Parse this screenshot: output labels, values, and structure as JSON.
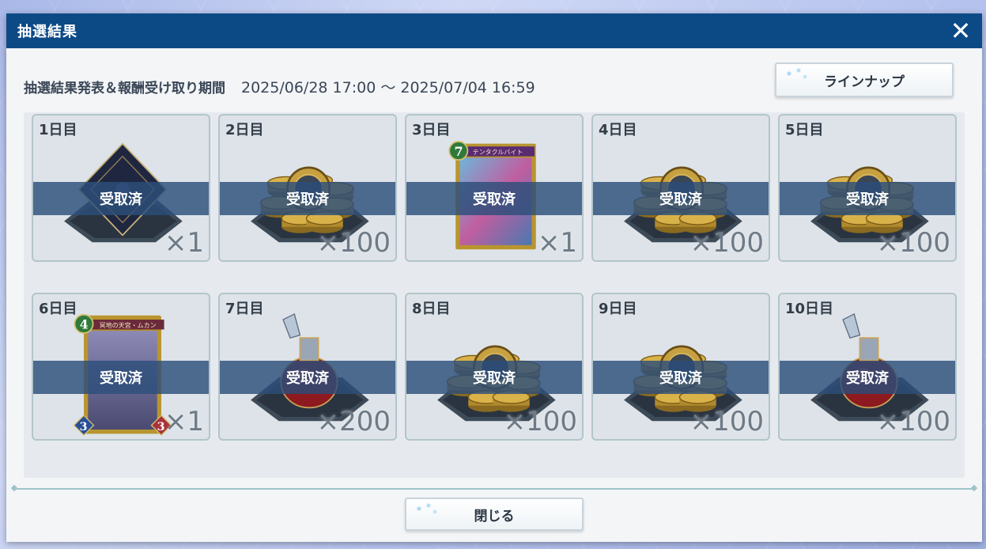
{
  "dialog": {
    "title": "抽選結果",
    "period_label": "抽選結果発表＆報酬受け取り期間",
    "period_value": "2025/06/28 17:00 〜 2025/07/04 16:59",
    "lineup_button": "ラインナップ",
    "close_button": "閉じる"
  },
  "rewards": [
    {
      "day": "1日目",
      "item": "sleeve",
      "status": "受取済",
      "qty": "×1"
    },
    {
      "day": "2日目",
      "item": "coins",
      "status": "受取済",
      "qty": "×100"
    },
    {
      "day": "3日目",
      "item": "card",
      "card_cost": "7",
      "card_name": "テンタクルバイト",
      "status": "受取済",
      "qty": "×1"
    },
    {
      "day": "4日目",
      "item": "coins",
      "status": "受取済",
      "qty": "×100"
    },
    {
      "day": "5日目",
      "item": "coins",
      "status": "受取済",
      "qty": "×100"
    },
    {
      "day": "6日目",
      "item": "card",
      "card_cost": "4",
      "card_name": "冥地の天宮・ムカン",
      "card_atk": "3",
      "card_def": "3",
      "status": "受取済",
      "qty": "×1"
    },
    {
      "day": "7日目",
      "item": "potion",
      "status": "受取済",
      "qty": "×200"
    },
    {
      "day": "8日目",
      "item": "coins",
      "status": "受取済",
      "qty": "×100"
    },
    {
      "day": "9日目",
      "item": "coins",
      "status": "受取済",
      "qty": "×100"
    },
    {
      "day": "10日目",
      "item": "potion",
      "status": "受取済",
      "qty": "×100"
    }
  ],
  "colors": {
    "titlebar": "#0c4a86",
    "claimed_band": "#2c4e7a",
    "cell_border": "#b3c5cb"
  },
  "icons": {
    "close": "close-icon",
    "sleeve": "card-sleeve-icon",
    "coins": "coins-icon",
    "potion": "potion-icon",
    "card": "card-icon"
  }
}
